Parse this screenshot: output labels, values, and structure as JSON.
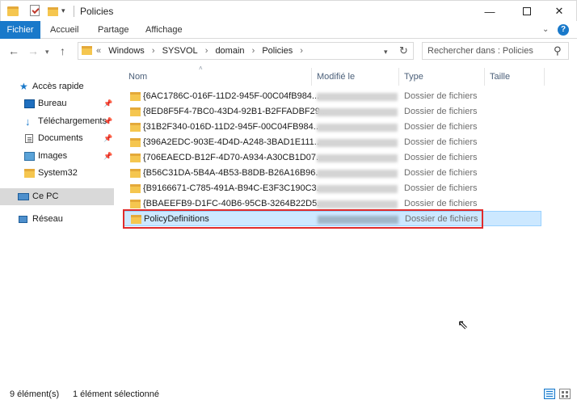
{
  "window": {
    "title": "Policies",
    "minimize": "—",
    "close": "✕"
  },
  "ribbon": {
    "tabs": [
      "Fichier",
      "Accueil",
      "Partage",
      "Affichage"
    ],
    "expand": "⌄",
    "help": "?"
  },
  "address": {
    "prefix": "«",
    "crumbs": [
      "Windows",
      "SYSVOL",
      "domain",
      "Policies"
    ],
    "separator": "›"
  },
  "search": {
    "placeholder": "Rechercher dans : Policies"
  },
  "nav_pane": {
    "items": [
      {
        "label": "Accès rapide",
        "icon": "star-icon",
        "pinned": false
      },
      {
        "label": "Bureau",
        "icon": "desktop-icon",
        "pinned": true
      },
      {
        "label": "Téléchargements",
        "icon": "download-icon",
        "pinned": true
      },
      {
        "label": "Documents",
        "icon": "documents-icon",
        "pinned": true
      },
      {
        "label": "Images",
        "icon": "pictures-icon",
        "pinned": true
      },
      {
        "label": "System32",
        "icon": "folder-icon",
        "pinned": false
      },
      {
        "label": "Ce PC",
        "icon": "computer-icon",
        "pinned": false,
        "selected": true
      },
      {
        "label": "Réseau",
        "icon": "network-icon",
        "pinned": false
      }
    ],
    "pin_glyph": "📌"
  },
  "columns": {
    "name": "Nom",
    "modified": "Modifié le",
    "type": "Type",
    "size": "Taille"
  },
  "files": [
    {
      "name": "{6AC1786C-016F-11D2-945F-00C04fB984...",
      "type": "Dossier de fichiers"
    },
    {
      "name": "{8ED8F5F4-7BC0-43D4-92B1-B2FFADBF29...",
      "type": "Dossier de fichiers"
    },
    {
      "name": "{31B2F340-016D-11D2-945F-00C04FB984...",
      "type": "Dossier de fichiers"
    },
    {
      "name": "{396A2EDC-903E-4D4D-A248-3BAD1E111...",
      "type": "Dossier de fichiers"
    },
    {
      "name": "{706EAECD-B12F-4D70-A934-A30CB1D07...",
      "type": "Dossier de fichiers"
    },
    {
      "name": "{B56C31DA-5B4A-4B53-B8DB-B26A16B96...",
      "type": "Dossier de fichiers"
    },
    {
      "name": "{B9166671-C785-491A-B94C-E3F3C190C3...",
      "type": "Dossier de fichiers"
    },
    {
      "name": "{BBAEEFB9-D1FC-40B6-95CB-3264B22D5...",
      "type": "Dossier de fichiers"
    },
    {
      "name": "PolicyDefinitions",
      "type": "Dossier de fichiers",
      "selected": true
    }
  ],
  "status": {
    "count": "9 élément(s)",
    "selection": "1 élément sélectionné"
  },
  "colors": {
    "accent": "#1979ca",
    "selection": "#cce8ff",
    "highlight": "#e02b2b",
    "folder": "#f5c64f"
  }
}
